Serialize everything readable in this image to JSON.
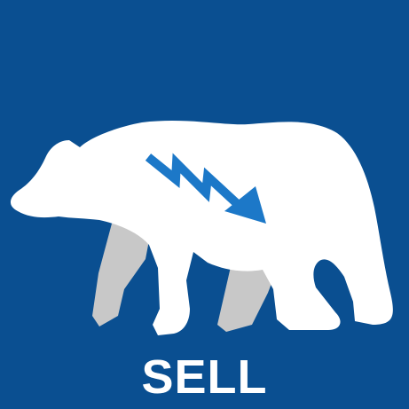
{
  "caption": "SELL",
  "illustration": {
    "subject": "bear-silhouette",
    "icon": "falling-zigzag-arrow-icon"
  },
  "colors": {
    "background": "#0a4f91",
    "bear_body": "#ffffff",
    "bear_back_legs": "#c8c8c8",
    "arrow": "#1c78c8",
    "text": "#ffffff"
  }
}
